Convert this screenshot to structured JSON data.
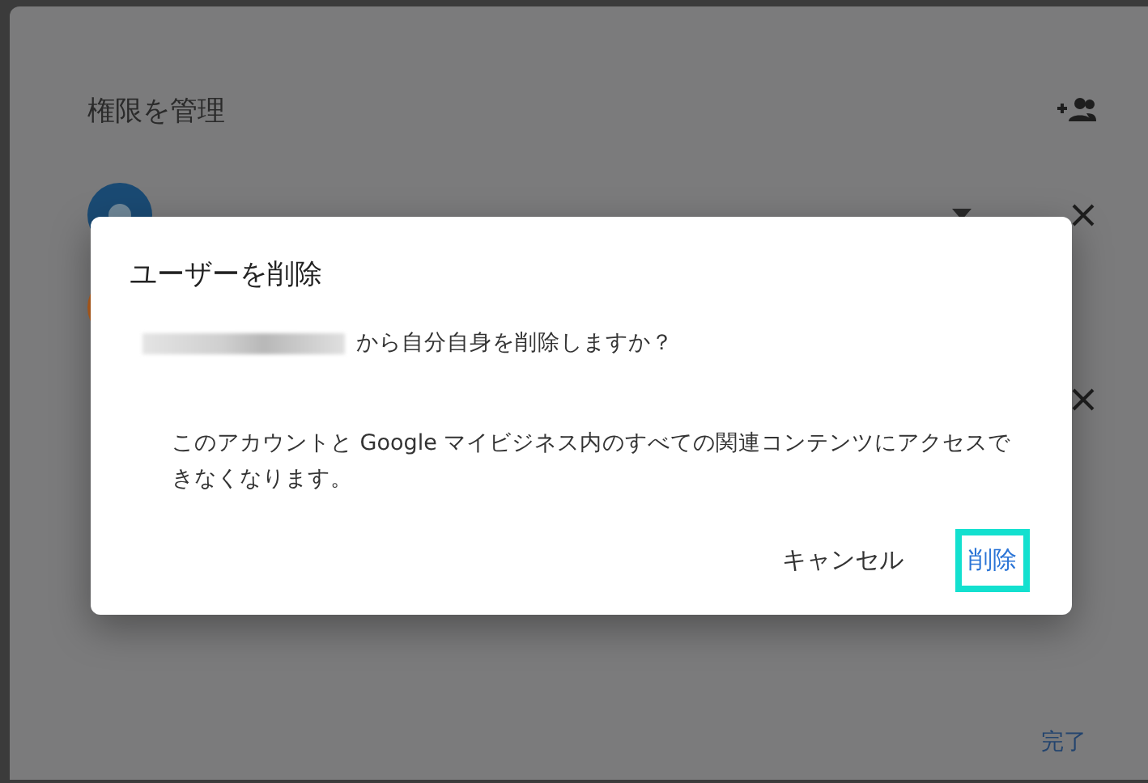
{
  "panel": {
    "title": "権限を管理",
    "rows": [
      {
        "kind": "owner"
      },
      {
        "kind": "avatar-only"
      },
      {
        "kind": "remove-only"
      }
    ],
    "done_button": "完了"
  },
  "dialog": {
    "title": "ユーザーを削除",
    "question": "から自分自身を削除しますか？",
    "body": "このアカウントと Google マイビジネス内のすべての関連コンテンツにアクセスできなくなります。",
    "buttons": [
      {
        "label": "キャンセル",
        "highlighted": false
      },
      {
        "label": "削除",
        "highlighted": true
      }
    ]
  }
}
